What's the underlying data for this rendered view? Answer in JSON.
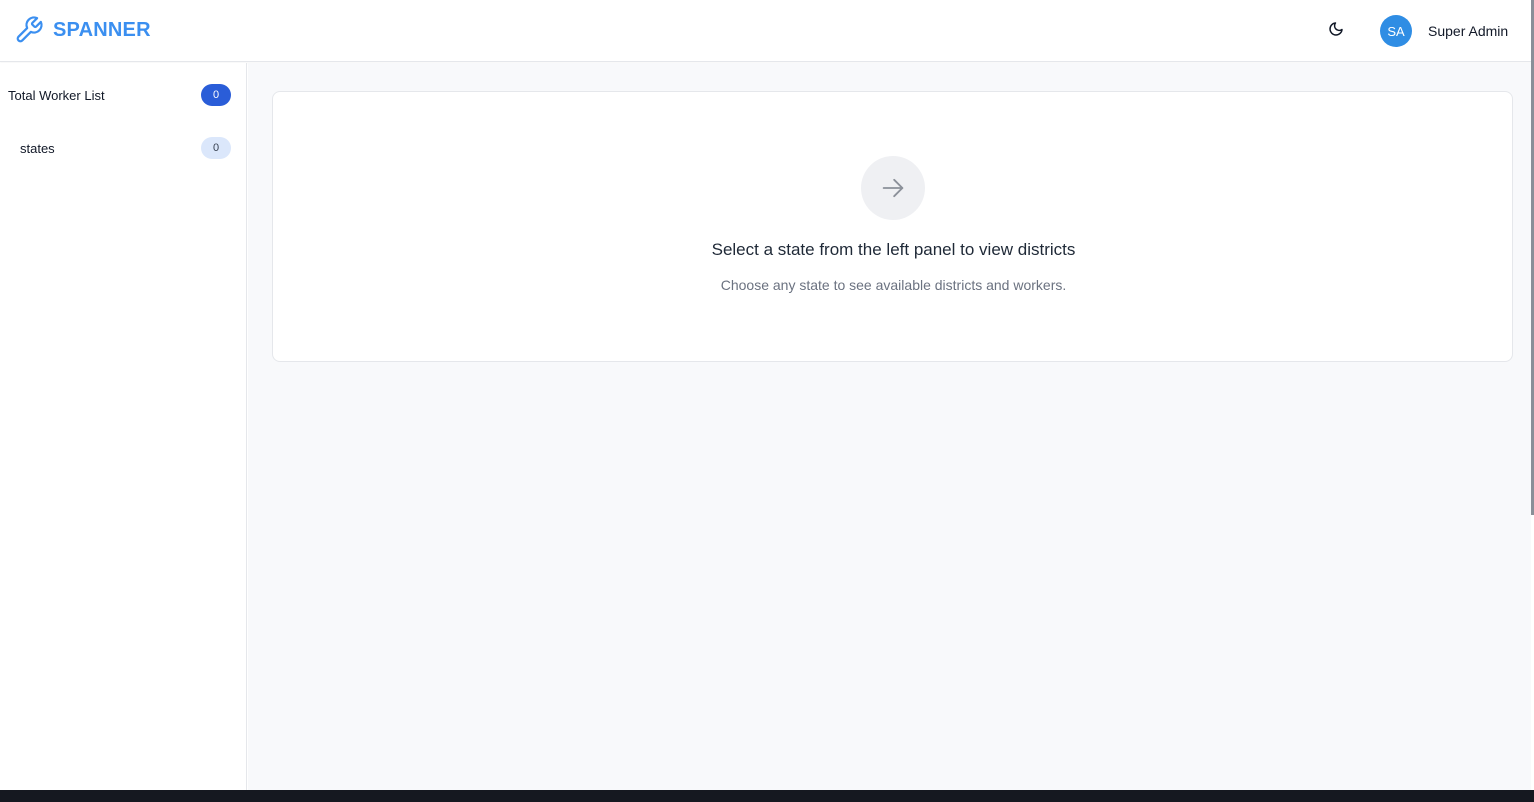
{
  "header": {
    "brand_name": "SPANNER",
    "brand_sub": "",
    "page_title": "",
    "theme_icon": "moon-icon",
    "avatar_initials": "SA",
    "user_name": "Super Admin",
    "accent_color": "#3b8ff0"
  },
  "sidebar": {
    "items": [
      {
        "label": "Total Worker List",
        "count": "0"
      },
      {
        "label": "states",
        "count": "0"
      }
    ]
  },
  "main": {
    "empty_state": {
      "icon": "arrow-right-icon",
      "title": "Select a state from the left panel to view districts",
      "subtitle": "Choose any state to see available districts and workers."
    }
  }
}
